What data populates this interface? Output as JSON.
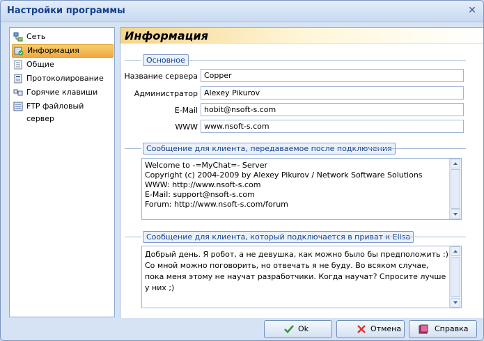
{
  "window": {
    "title": "Настройки программы",
    "close_glyph": "✕"
  },
  "sidebar": {
    "items": [
      {
        "label": "Сеть",
        "icon": "network-icon"
      },
      {
        "label": "Информация",
        "icon": "info-icon",
        "active": true
      },
      {
        "label": "Общие",
        "icon": "document-icon"
      },
      {
        "label": "Протоколирование",
        "icon": "log-icon"
      },
      {
        "label": "Горячие клавиши",
        "icon": "keyboard-icon"
      },
      {
        "label": "FTP файловый сервер",
        "icon": "ftp-icon"
      }
    ]
  },
  "panel": {
    "title": "Информация",
    "basic": {
      "legend": "Основное",
      "fields": [
        {
          "label": "Название сервера",
          "value": "Copper"
        },
        {
          "label": "Администратор",
          "value": "Alexey Pikurov"
        },
        {
          "label": "E-Mail",
          "value": "hobit@nsoft-s.com"
        },
        {
          "label": "WWW",
          "value": "www.nsoft-s.com"
        }
      ]
    },
    "connect_message": {
      "legend": "Сообщение для клиента, передаваемое после подключения",
      "text": "Welcome to -=MyChat=- Server\nCopyright (c) 2004-2009 by Alexey Pikurov / Network Software Solutions\nWWW: http://www.nsoft-s.com\nE-Mail: support@nsoft-s.com\nForum: http://www.nsoft-s.com/forum"
    },
    "private_message": {
      "legend": "Сообщение для клиента, который подключается в приват к Elisa",
      "text": "Добрый день. Я робот, а не девушка, как можно было бы предположить :) Со мной можно поговорить, но отвечать я не буду. Во всяком случае, пока меня этому не научат разработчики. Когда научат? Спросите лучше у них ;)"
    }
  },
  "buttons": {
    "ok": "Ok",
    "cancel": "Отмена",
    "help": "Справка"
  },
  "colors": {
    "accent": "#f0a83b",
    "title_text": "#15428b",
    "frame": "#7b96c2"
  }
}
